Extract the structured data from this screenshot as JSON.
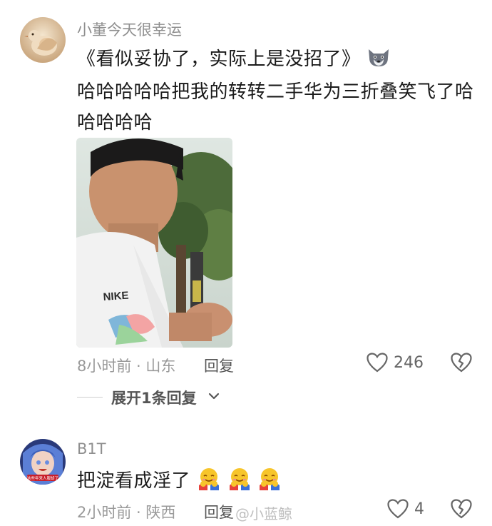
{
  "comments": [
    {
      "username": "小董今天很幸运",
      "lines": [
        "《看似妥协了，实际上是没招了》",
        "哈哈哈哈哈把我的转转二手华为三折叠笑飞了哈",
        "哈哈哈哈"
      ],
      "photo_print": "NIKE",
      "meta": "8小时前 · 山东",
      "reply_label": "回复",
      "likes": "246"
    },
    {
      "username": "B1T",
      "text": "把淀看成淫了",
      "avatar_caption": "这些年来人服却了",
      "meta": "2小时前 · 陕西",
      "reply_label": "回复",
      "likes": "4"
    }
  ],
  "expand_replies_label": "展开1条回复",
  "watermark": "@小蓝鲸",
  "icons": [
    "heart-outline-icon",
    "broken-heart-icon",
    "chevron-down-icon",
    "wolf-emoji-icon",
    "hug-emoji-icon"
  ],
  "colors": {
    "text": "#1a1a1a",
    "meta": "#9a9a9a",
    "username": "#8f8f8f",
    "background": "#ffffff"
  }
}
